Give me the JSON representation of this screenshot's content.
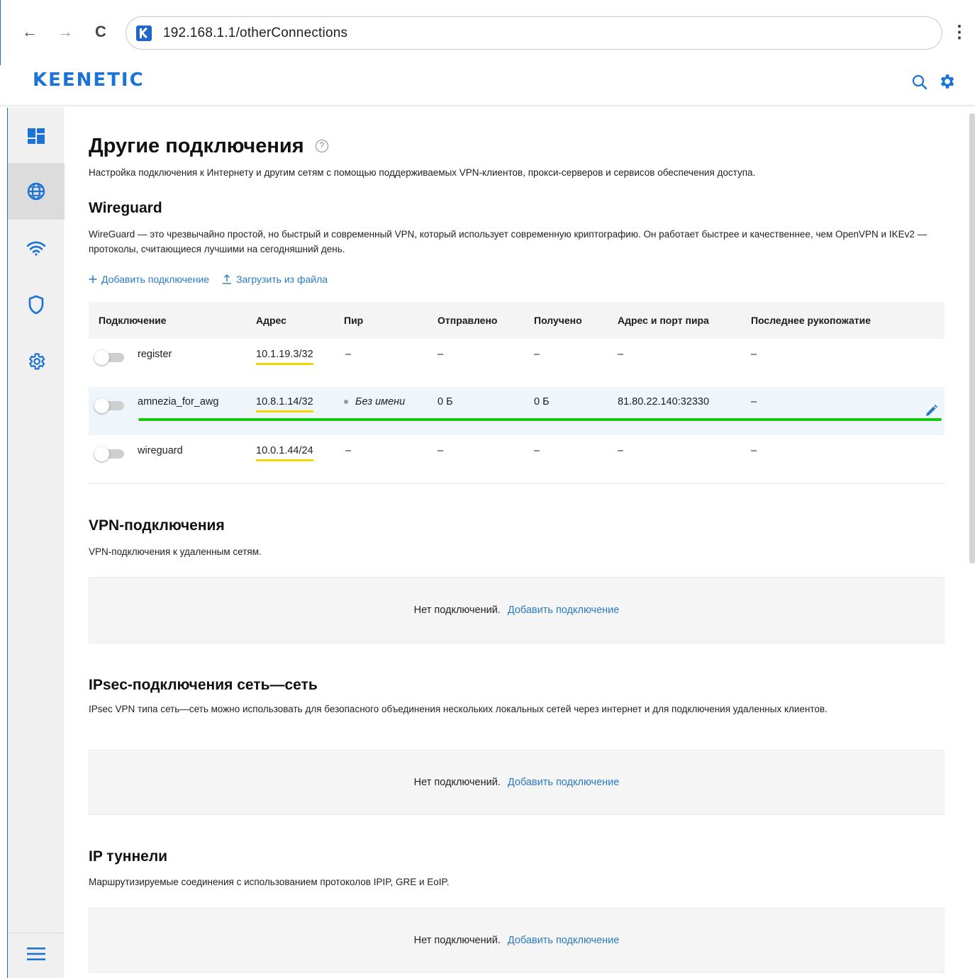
{
  "browser": {
    "url": "192.168.1.1/otherConnections",
    "back": "←",
    "forward": "→",
    "reload": "C",
    "menu": "⋮"
  },
  "app": {
    "brand": "KEENETIC"
  },
  "sidebar": {
    "items": [
      {
        "name": "dashboard-icon"
      },
      {
        "name": "internet-globe-icon",
        "active": true
      },
      {
        "name": "wifi-icon"
      },
      {
        "name": "shield-icon"
      },
      {
        "name": "settings-gear-icon"
      }
    ],
    "menu_icon": "hamburger-menu-icon"
  },
  "page": {
    "title": "Другие подключения",
    "help": "?",
    "description": "Настройка подключения к Интернету и другим сетям с помощью поддерживаемых VPN-клиентов, прокси-серверов и сервисов обеспечения доступа."
  },
  "wireguard": {
    "title": "Wireguard",
    "description": "WireGuard — это чрезвычайно простой, но быстрый и современный VPN, который использует современную криптографию. Он работает быстрее и качественнее, чем OpenVPN и IKEv2 — протоколы, считающиеся лучшими на сегодняшний день.",
    "add_label": "Добавить подключение",
    "upload_label": "Загрузить из файла",
    "columns": [
      "Подключение",
      "Адрес",
      "Пир",
      "Отправлено",
      "Получено",
      "Адрес и порт пира",
      "Последнее рукопожатие"
    ],
    "rows": [
      {
        "name": "register",
        "address": "10.1.19.3/32",
        "peer": "–",
        "sent": "–",
        "received": "–",
        "peer_addr": "–",
        "handshake": "–",
        "enabled": false
      },
      {
        "name": "amnezia_for_awg",
        "address": "10.8.1.14/32",
        "peer": "Без имени",
        "sent": "0 Б",
        "received": "0 Б",
        "peer_addr": "81.80.22.140:32330",
        "handshake": "–",
        "enabled": false
      },
      {
        "name": "wireguard",
        "address": "10.0.1.44/24",
        "peer": "–",
        "sent": "–",
        "received": "–",
        "peer_addr": "–",
        "handshake": "–",
        "enabled": false
      }
    ]
  },
  "vpn": {
    "title": "VPN-подключения",
    "description": "VPN-подключения к удаленным сетям.",
    "empty": "Нет подключений.",
    "add": "Добавить подключение"
  },
  "ipsec": {
    "title": "IPsec-подключения сеть—сеть",
    "description": "IPsec VPN типа сеть—сеть можно использовать для безопасного объединения нескольких локальных сетей через интернет и для подключения удаленных клиентов.",
    "empty": "Нет подключений.",
    "add": "Добавить подключение"
  },
  "tunnels": {
    "title": "IP туннели",
    "description": "Маршрутизируемые соединения с использованием протоколов IPIP, GRE и EoIP.",
    "empty": "Нет подключений.",
    "add": "Добавить подключение"
  },
  "colors": {
    "accent": "#1b73d8",
    "link": "#2a7ac2",
    "highlight_green": "#19c910",
    "highlight_yellow": "#f3d500"
  }
}
